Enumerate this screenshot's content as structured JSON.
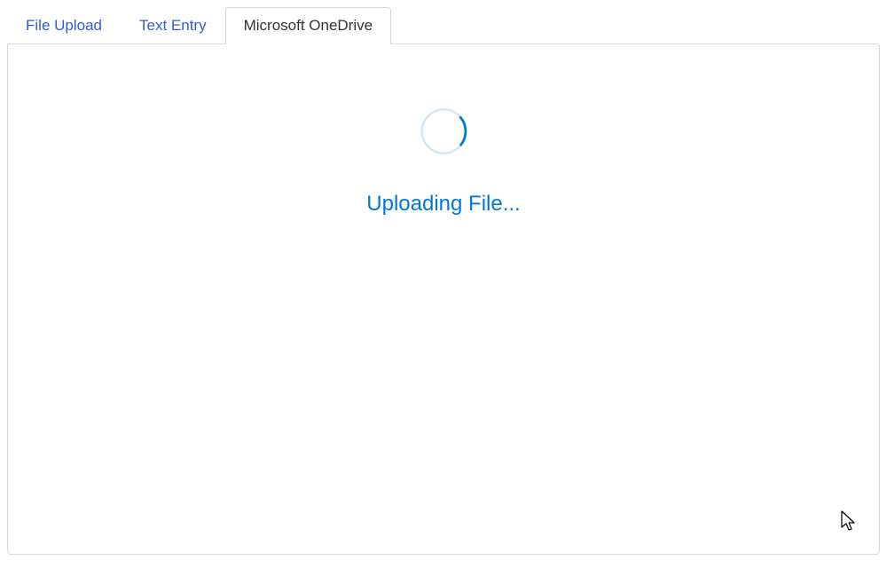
{
  "tabs": [
    {
      "label": "File Upload",
      "active": false
    },
    {
      "label": "Text Entry",
      "active": false
    },
    {
      "label": "Microsoft OneDrive",
      "active": true
    }
  ],
  "status": {
    "message": "Uploading File..."
  },
  "colors": {
    "tab_link": "#2f5fce",
    "tab_active_text": "#333333",
    "border": "#d6d6d6",
    "status_text": "#0078d4",
    "spinner_track": "#cfe4f5",
    "spinner_arc": "#0078d4"
  }
}
